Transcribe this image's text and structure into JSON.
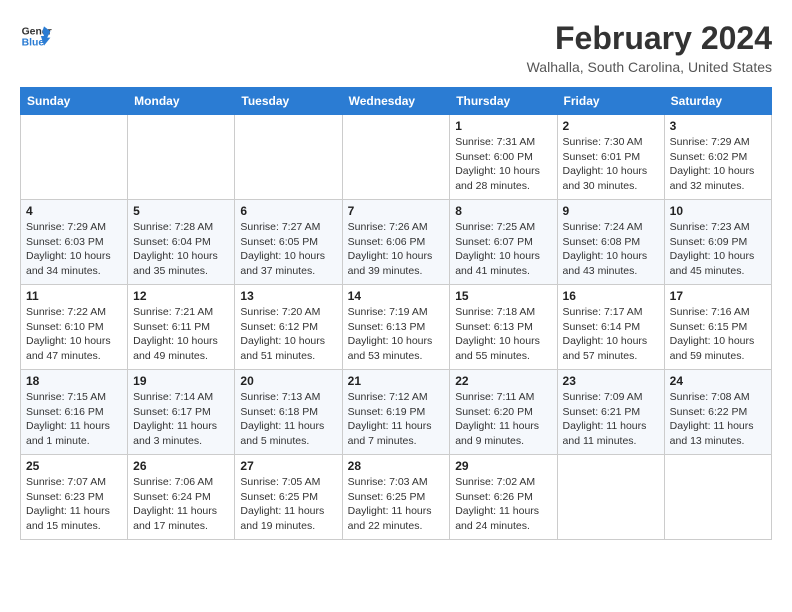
{
  "header": {
    "logo_line1": "General",
    "logo_line2": "Blue",
    "month_year": "February 2024",
    "location": "Walhalla, South Carolina, United States"
  },
  "days_of_week": [
    "Sunday",
    "Monday",
    "Tuesday",
    "Wednesday",
    "Thursday",
    "Friday",
    "Saturday"
  ],
  "weeks": [
    [
      {
        "day": "",
        "info": ""
      },
      {
        "day": "",
        "info": ""
      },
      {
        "day": "",
        "info": ""
      },
      {
        "day": "",
        "info": ""
      },
      {
        "day": "1",
        "info": "Sunrise: 7:31 AM\nSunset: 6:00 PM\nDaylight: 10 hours\nand 28 minutes."
      },
      {
        "day": "2",
        "info": "Sunrise: 7:30 AM\nSunset: 6:01 PM\nDaylight: 10 hours\nand 30 minutes."
      },
      {
        "day": "3",
        "info": "Sunrise: 7:29 AM\nSunset: 6:02 PM\nDaylight: 10 hours\nand 32 minutes."
      }
    ],
    [
      {
        "day": "4",
        "info": "Sunrise: 7:29 AM\nSunset: 6:03 PM\nDaylight: 10 hours\nand 34 minutes."
      },
      {
        "day": "5",
        "info": "Sunrise: 7:28 AM\nSunset: 6:04 PM\nDaylight: 10 hours\nand 35 minutes."
      },
      {
        "day": "6",
        "info": "Sunrise: 7:27 AM\nSunset: 6:05 PM\nDaylight: 10 hours\nand 37 minutes."
      },
      {
        "day": "7",
        "info": "Sunrise: 7:26 AM\nSunset: 6:06 PM\nDaylight: 10 hours\nand 39 minutes."
      },
      {
        "day": "8",
        "info": "Sunrise: 7:25 AM\nSunset: 6:07 PM\nDaylight: 10 hours\nand 41 minutes."
      },
      {
        "day": "9",
        "info": "Sunrise: 7:24 AM\nSunset: 6:08 PM\nDaylight: 10 hours\nand 43 minutes."
      },
      {
        "day": "10",
        "info": "Sunrise: 7:23 AM\nSunset: 6:09 PM\nDaylight: 10 hours\nand 45 minutes."
      }
    ],
    [
      {
        "day": "11",
        "info": "Sunrise: 7:22 AM\nSunset: 6:10 PM\nDaylight: 10 hours\nand 47 minutes."
      },
      {
        "day": "12",
        "info": "Sunrise: 7:21 AM\nSunset: 6:11 PM\nDaylight: 10 hours\nand 49 minutes."
      },
      {
        "day": "13",
        "info": "Sunrise: 7:20 AM\nSunset: 6:12 PM\nDaylight: 10 hours\nand 51 minutes."
      },
      {
        "day": "14",
        "info": "Sunrise: 7:19 AM\nSunset: 6:13 PM\nDaylight: 10 hours\nand 53 minutes."
      },
      {
        "day": "15",
        "info": "Sunrise: 7:18 AM\nSunset: 6:13 PM\nDaylight: 10 hours\nand 55 minutes."
      },
      {
        "day": "16",
        "info": "Sunrise: 7:17 AM\nSunset: 6:14 PM\nDaylight: 10 hours\nand 57 minutes."
      },
      {
        "day": "17",
        "info": "Sunrise: 7:16 AM\nSunset: 6:15 PM\nDaylight: 10 hours\nand 59 minutes."
      }
    ],
    [
      {
        "day": "18",
        "info": "Sunrise: 7:15 AM\nSunset: 6:16 PM\nDaylight: 11 hours\nand 1 minute."
      },
      {
        "day": "19",
        "info": "Sunrise: 7:14 AM\nSunset: 6:17 PM\nDaylight: 11 hours\nand 3 minutes."
      },
      {
        "day": "20",
        "info": "Sunrise: 7:13 AM\nSunset: 6:18 PM\nDaylight: 11 hours\nand 5 minutes."
      },
      {
        "day": "21",
        "info": "Sunrise: 7:12 AM\nSunset: 6:19 PM\nDaylight: 11 hours\nand 7 minutes."
      },
      {
        "day": "22",
        "info": "Sunrise: 7:11 AM\nSunset: 6:20 PM\nDaylight: 11 hours\nand 9 minutes."
      },
      {
        "day": "23",
        "info": "Sunrise: 7:09 AM\nSunset: 6:21 PM\nDaylight: 11 hours\nand 11 minutes."
      },
      {
        "day": "24",
        "info": "Sunrise: 7:08 AM\nSunset: 6:22 PM\nDaylight: 11 hours\nand 13 minutes."
      }
    ],
    [
      {
        "day": "25",
        "info": "Sunrise: 7:07 AM\nSunset: 6:23 PM\nDaylight: 11 hours\nand 15 minutes."
      },
      {
        "day": "26",
        "info": "Sunrise: 7:06 AM\nSunset: 6:24 PM\nDaylight: 11 hours\nand 17 minutes."
      },
      {
        "day": "27",
        "info": "Sunrise: 7:05 AM\nSunset: 6:25 PM\nDaylight: 11 hours\nand 19 minutes."
      },
      {
        "day": "28",
        "info": "Sunrise: 7:03 AM\nSunset: 6:25 PM\nDaylight: 11 hours\nand 22 minutes."
      },
      {
        "day": "29",
        "info": "Sunrise: 7:02 AM\nSunset: 6:26 PM\nDaylight: 11 hours\nand 24 minutes."
      },
      {
        "day": "",
        "info": ""
      },
      {
        "day": "",
        "info": ""
      }
    ]
  ]
}
